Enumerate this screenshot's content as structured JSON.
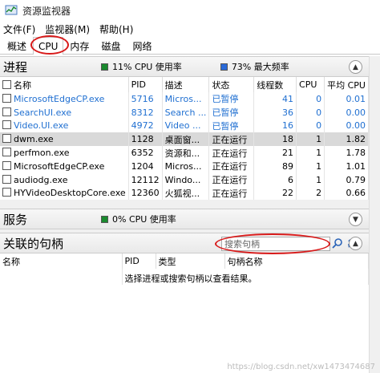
{
  "window": {
    "title": "资源监视器"
  },
  "menu": {
    "file": "文件(F)",
    "monitor": "监视器(M)",
    "help": "帮助(H)"
  },
  "tabs": [
    {
      "label": "概述"
    },
    {
      "label": "CPU"
    },
    {
      "label": "内存"
    },
    {
      "label": "磁盘"
    },
    {
      "label": "网络"
    }
  ],
  "processes": {
    "title": "进程",
    "cpu_usage": "11% CPU 使用率",
    "max_freq": "73% 最大频率",
    "columns": [
      "名称",
      "PID",
      "描述",
      "状态",
      "线程数",
      "CPU",
      "平均 CPU"
    ],
    "rows": [
      {
        "name": "MicrosoftEdgeCP.exe",
        "pid": "5716",
        "desc": "Micros...",
        "status": "已暂停",
        "threads": "41",
        "cpu": "0",
        "avg": "0.01",
        "suspended": true
      },
      {
        "name": "SearchUI.exe",
        "pid": "8312",
        "desc": "Search ...",
        "status": "已暂停",
        "threads": "36",
        "cpu": "0",
        "avg": "0.00",
        "suspended": true
      },
      {
        "name": "Video.UI.exe",
        "pid": "4972",
        "desc": "Video ...",
        "status": "已暂停",
        "threads": "16",
        "cpu": "0",
        "avg": "0.00",
        "suspended": true
      },
      {
        "name": "dwm.exe",
        "pid": "1128",
        "desc": "桌面窗...",
        "status": "正在运行",
        "threads": "18",
        "cpu": "1",
        "avg": "1.82",
        "selected": true
      },
      {
        "name": "perfmon.exe",
        "pid": "6352",
        "desc": "资源和...",
        "status": "正在运行",
        "threads": "21",
        "cpu": "1",
        "avg": "1.78"
      },
      {
        "name": "MicrosoftEdgeCP.exe",
        "pid": "1204",
        "desc": "Micros...",
        "status": "正在运行",
        "threads": "89",
        "cpu": "1",
        "avg": "1.01"
      },
      {
        "name": "audiodg.exe",
        "pid": "12112",
        "desc": "Windo...",
        "status": "正在运行",
        "threads": "6",
        "cpu": "1",
        "avg": "0.79"
      },
      {
        "name": "HYVideoDesktopCore.exe",
        "pid": "12360",
        "desc": "火狐视...",
        "status": "正在运行",
        "threads": "22",
        "cpu": "2",
        "avg": "0.66"
      }
    ]
  },
  "services": {
    "title": "服务",
    "cpu_usage": "0% CPU 使用率"
  },
  "handles": {
    "title": "关联的句柄",
    "search_placeholder": "搜索句柄",
    "columns": [
      "名称",
      "PID",
      "类型",
      "句柄名称"
    ],
    "hint": "选择进程或搜索句柄以查看结果。"
  },
  "colors": {
    "cpu_green": "#1a8a2e",
    "freq_blue": "#2a6ad8",
    "suspended_text": "#1f6fd1",
    "annotation": "#d81a1a"
  },
  "watermark": "https://blog.csdn.net/xw1473474687"
}
